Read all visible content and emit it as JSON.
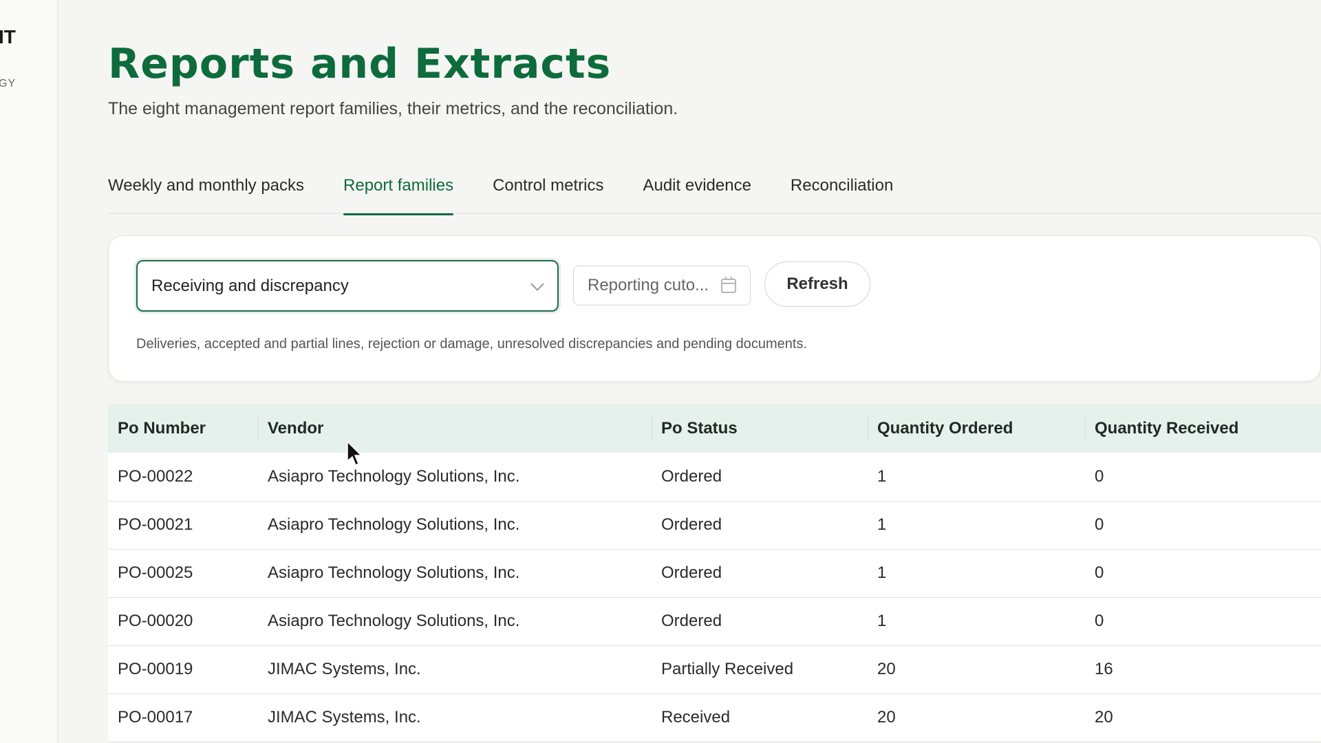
{
  "sidebar": {
    "brand_mark": "IT",
    "brand_sub": "GY"
  },
  "header": {
    "title": "Reports and Extracts",
    "subtitle": "The eight management report families, their metrics, and the reconciliation."
  },
  "tabs": [
    {
      "label": "Weekly and monthly packs",
      "active": false
    },
    {
      "label": "Report families",
      "active": true
    },
    {
      "label": "Control metrics",
      "active": false
    },
    {
      "label": "Audit evidence",
      "active": false
    },
    {
      "label": "Reconciliation",
      "active": false
    }
  ],
  "filters": {
    "report_family": "Receiving and discrepancy",
    "cutoff_placeholder": "Reporting cuto...",
    "refresh_label": "Refresh",
    "description": "Deliveries, accepted and partial lines, rejection or damage, unresolved discrepancies and pending documents."
  },
  "table": {
    "columns": [
      "Po Number",
      "Vendor",
      "Po Status",
      "Quantity Ordered",
      "Quantity Received"
    ],
    "rows": [
      [
        "PO-00022",
        "Asiapro Technology Solutions, Inc.",
        "Ordered",
        "1",
        "0"
      ],
      [
        "PO-00021",
        "Asiapro Technology Solutions, Inc.",
        "Ordered",
        "1",
        "0"
      ],
      [
        "PO-00025",
        "Asiapro Technology Solutions, Inc.",
        "Ordered",
        "1",
        "0"
      ],
      [
        "PO-00020",
        "Asiapro Technology Solutions, Inc.",
        "Ordered",
        "1",
        "0"
      ],
      [
        "PO-00019",
        "JIMAC Systems, Inc.",
        "Partially Received",
        "20",
        "16"
      ],
      [
        "PO-00017",
        "JIMAC Systems, Inc.",
        "Received",
        "20",
        "20"
      ]
    ]
  },
  "colors": {
    "accent": "#0d6b3c",
    "header_bg": "#e6f0ec"
  }
}
